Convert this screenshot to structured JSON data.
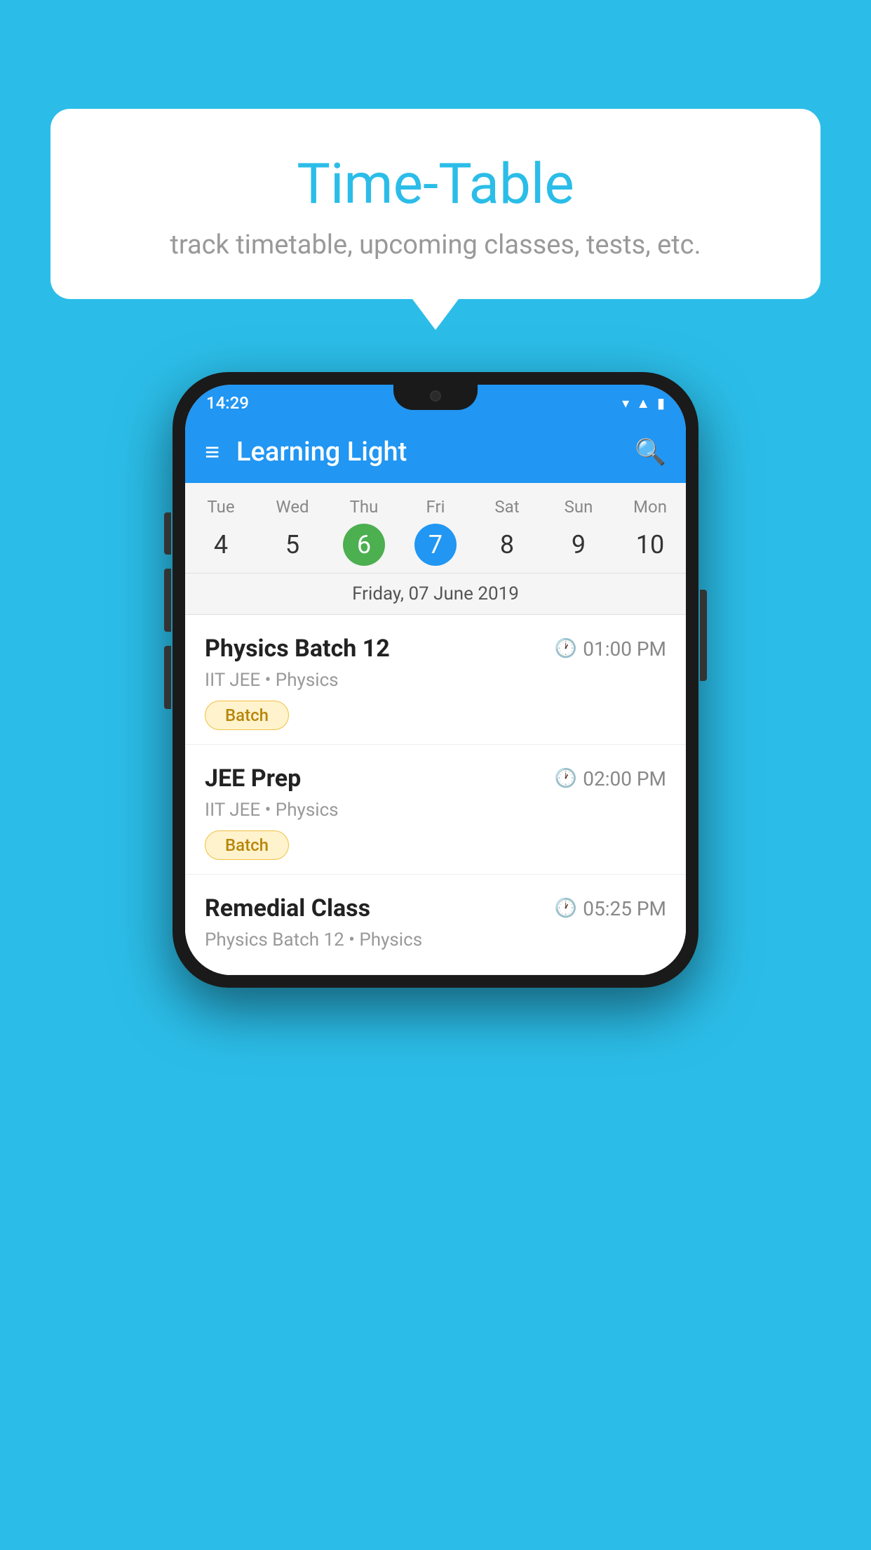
{
  "background_color": "#2bbde8",
  "bubble": {
    "title": "Time-Table",
    "subtitle": "track timetable, upcoming classes, tests, etc."
  },
  "phone": {
    "status_bar": {
      "time": "14:29",
      "icons": [
        "wifi",
        "signal",
        "battery"
      ]
    },
    "app_bar": {
      "title": "Learning Light",
      "menu_icon": "☰",
      "search_icon": "🔍"
    },
    "calendar": {
      "days": [
        {
          "name": "Tue",
          "num": "4",
          "style": "normal"
        },
        {
          "name": "Wed",
          "num": "5",
          "style": "normal"
        },
        {
          "name": "Thu",
          "num": "6",
          "style": "today"
        },
        {
          "name": "Fri",
          "num": "7",
          "style": "selected"
        },
        {
          "name": "Sat",
          "num": "8",
          "style": "normal"
        },
        {
          "name": "Sun",
          "num": "9",
          "style": "normal"
        },
        {
          "name": "Mon",
          "num": "10",
          "style": "normal"
        }
      ],
      "selected_date_label": "Friday, 07 June 2019"
    },
    "classes": [
      {
        "name": "Physics Batch 12",
        "time": "01:00 PM",
        "meta": "IIT JEE • Physics",
        "badge": "Batch"
      },
      {
        "name": "JEE Prep",
        "time": "02:00 PM",
        "meta": "IIT JEE • Physics",
        "badge": "Batch"
      },
      {
        "name": "Remedial Class",
        "time": "05:25 PM",
        "meta": "Physics Batch 12 • Physics",
        "badge": ""
      }
    ]
  }
}
